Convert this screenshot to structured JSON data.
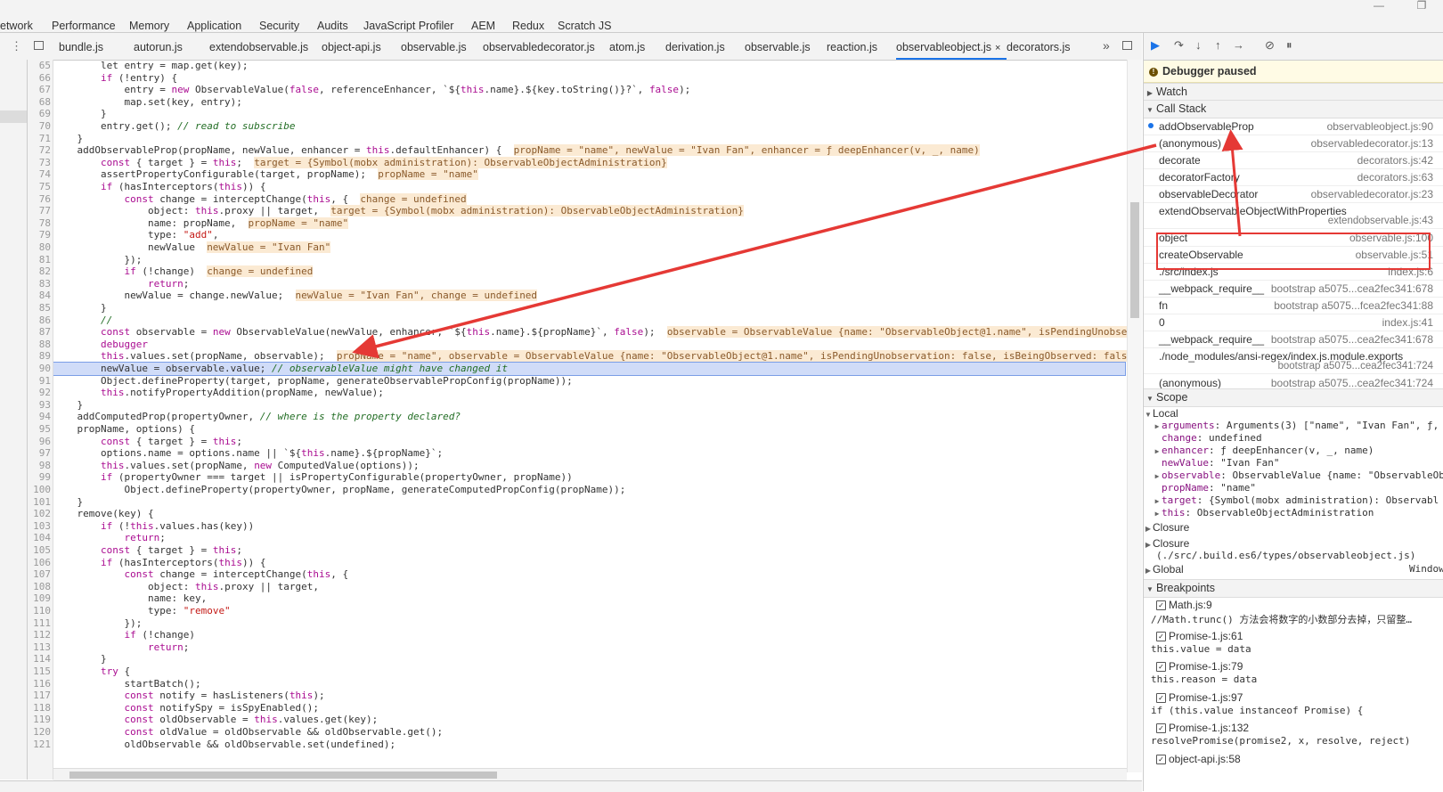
{
  "panel_tabs": [
    "etwork",
    "Performance",
    "Memory",
    "Application",
    "Security",
    "Audits",
    "JavaScript Profiler",
    "AEM",
    "Redux",
    "Scratch JS"
  ],
  "file_tabs": [
    "bundle.js",
    "autorun.js",
    "extendobservable.js",
    "object-api.js",
    "observable.js",
    "observabledecorator.js",
    "atom.js",
    "derivation.js",
    "observable.js",
    "reaction.js",
    "observableobject.js",
    "decorators.js"
  ],
  "active_file_tab": "observableobject.js",
  "close_glyph": "×",
  "more_tabs_glyph": "»",
  "debugger_paused": "Debugger paused",
  "sections": {
    "watch": "Watch",
    "call_stack": "Call Stack",
    "scope": "Scope",
    "breakpoints": "Breakpoints"
  },
  "call_stack": [
    {
      "fn": "addObservableProp",
      "loc": "observableobject.js:90",
      "current": true
    },
    {
      "fn": "(anonymous)",
      "loc": "observabledecorator.js:13"
    },
    {
      "fn": "decorate",
      "loc": "decorators.js:42"
    },
    {
      "fn": "decoratorFactory",
      "loc": "decorators.js:63"
    },
    {
      "fn": "observableDecorator",
      "loc": "observabledecorator.js:23"
    },
    {
      "fn": "extendObservableObjectWithProperties",
      "loc": "extendobservable.js:43"
    },
    {
      "fn": "object",
      "loc": "observable.js:100"
    },
    {
      "fn": "createObservable",
      "loc": "observable.js:51"
    },
    {
      "fn": "./src/index.js",
      "loc": "index.js:6"
    },
    {
      "fn": "__webpack_require__",
      "loc": "bootstrap a5075...cea2fec341:678"
    },
    {
      "fn": "fn",
      "loc": "bootstrap a5075...fcea2fec341:88"
    },
    {
      "fn": "0",
      "loc": "index.js:41"
    },
    {
      "fn": "__webpack_require__",
      "loc": "bootstrap a5075...cea2fec341:678"
    },
    {
      "fn": "./node_modules/ansi-regex/index.js.module.exports",
      "loc": "bootstrap a5075...cea2fec341:724"
    },
    {
      "fn": "(anonymous)",
      "loc": "bootstrap a5075...cea2fec341:724"
    }
  ],
  "scope": {
    "local_label": "Local",
    "local_items": [
      {
        "expand": true,
        "name": "arguments",
        "value": "Arguments(3) [\"name\", \"Ivan Fan\", ƒ,"
      },
      {
        "expand": false,
        "name": "change",
        "value": "undefined"
      },
      {
        "expand": true,
        "name": "enhancer",
        "value": "ƒ deepEnhancer(v, _, name)"
      },
      {
        "expand": false,
        "name": "newValue",
        "value": "\"Ivan Fan\""
      },
      {
        "expand": true,
        "name": "observable",
        "value": "ObservableValue {name: \"ObservableOb"
      },
      {
        "expand": false,
        "name": "propName",
        "value": "\"name\""
      },
      {
        "expand": true,
        "name": "target",
        "value": "{Symbol(mobx administration): Observabl"
      },
      {
        "expand": true,
        "name": "this",
        "value": "ObservableObjectAdministration"
      }
    ],
    "closure1": "Closure",
    "closure2": "Closure",
    "closure2_path": "(./src/.build.es6/types/observableobject.js)",
    "global": "Global",
    "global_value": "Window"
  },
  "breakpoints": [
    {
      "file": "Math.js:9",
      "code": "//Math.trunc() 方法会将数字的小数部分去掉，只留整…"
    },
    {
      "file": "Promise-1.js:61",
      "code": "this.value = data"
    },
    {
      "file": "Promise-1.js:79",
      "code": "this.reason = data"
    },
    {
      "file": "Promise-1.js:97",
      "code": "if (this.value instanceof Promise) {"
    },
    {
      "file": "Promise-1.js:132",
      "code": "resolvePromise(promise2, x, resolve, reject)"
    },
    {
      "file": "object-api.js:58",
      "code": ""
    }
  ],
  "first_line_number": 65,
  "current_line_number": 90,
  "code_lines": [
    [
      [
        "        let entry = map.get(key);",
        "p"
      ]
    ],
    [
      [
        "        ",
        "p"
      ],
      [
        "if",
        "kw"
      ],
      [
        " (!entry) {",
        "p"
      ]
    ],
    [
      [
        "            entry = ",
        "p"
      ],
      [
        "new",
        "kw"
      ],
      [
        " ObservableValue(",
        "p"
      ],
      [
        "false",
        "kw"
      ],
      [
        ", referenceEnhancer, `${",
        "p"
      ],
      [
        "this",
        "kw"
      ],
      [
        ".name}.${key.toString()}?`, ",
        "p"
      ],
      [
        "false",
        "kw"
      ],
      [
        ");",
        "p"
      ]
    ],
    [
      [
        "            map.set(key, entry);",
        "p"
      ]
    ],
    [
      [
        "        }",
        "p"
      ]
    ],
    [
      [
        "        entry.get(); ",
        "p"
      ],
      [
        "// read to subscribe",
        "cm"
      ]
    ],
    [
      [
        "    }",
        "p"
      ]
    ],
    [
      [
        "    addObservableProp(propName, newValue, enhancer = ",
        "p"
      ],
      [
        "this",
        "kw"
      ],
      [
        ".defaultEnhancer) {  ",
        "p"
      ],
      [
        "propName = \"name\", newValue = \"Ivan Fan\", enhancer = ƒ deepEnhancer(v, _, name)",
        "iv"
      ]
    ],
    [
      [
        "        ",
        "p"
      ],
      [
        "const",
        "kw"
      ],
      [
        " { target } = ",
        "p"
      ],
      [
        "this",
        "kw"
      ],
      [
        ";  ",
        "p"
      ],
      [
        "target = {Symbol(mobx administration): ObservableObjectAdministration}",
        "iv"
      ]
    ],
    [
      [
        "        assertPropertyConfigurable(target, propName);  ",
        "p"
      ],
      [
        "propName = \"name\"",
        "iv"
      ]
    ],
    [
      [
        "        ",
        "p"
      ],
      [
        "if",
        "kw"
      ],
      [
        " (hasInterceptors(",
        "p"
      ],
      [
        "this",
        "kw"
      ],
      [
        ")) {",
        "p"
      ]
    ],
    [
      [
        "            ",
        "p"
      ],
      [
        "const",
        "kw"
      ],
      [
        " change = interceptChange(",
        "p"
      ],
      [
        "this",
        "kw"
      ],
      [
        ", {  ",
        "p"
      ],
      [
        "change = undefined",
        "iv"
      ]
    ],
    [
      [
        "                object: ",
        "p"
      ],
      [
        "this",
        "kw"
      ],
      [
        ".proxy || target,  ",
        "p"
      ],
      [
        "target = {Symbol(mobx administration): ObservableObjectAdministration}",
        "iv"
      ]
    ],
    [
      [
        "                name: propName,  ",
        "p"
      ],
      [
        "propName = \"name\"",
        "iv"
      ]
    ],
    [
      [
        "                type: ",
        "p"
      ],
      [
        "\"add\"",
        "str"
      ],
      [
        ",",
        "p"
      ]
    ],
    [
      [
        "                newValue  ",
        "p"
      ],
      [
        "newValue = \"Ivan Fan\"",
        "iv"
      ]
    ],
    [
      [
        "            });",
        "p"
      ]
    ],
    [
      [
        "            ",
        "p"
      ],
      [
        "if",
        "kw"
      ],
      [
        " (!change)  ",
        "p"
      ],
      [
        "change = undefined",
        "iv"
      ]
    ],
    [
      [
        "                ",
        "p"
      ],
      [
        "return",
        "kw"
      ],
      [
        ";",
        "p"
      ]
    ],
    [
      [
        "            newValue = change.newValue;  ",
        "p"
      ],
      [
        "newValue = \"Ivan Fan\", change = undefined",
        "iv"
      ]
    ],
    [
      [
        "        }",
        "p"
      ]
    ],
    [
      [
        "        ",
        "p"
      ],
      [
        "//",
        "cm"
      ]
    ],
    [
      [
        "        ",
        "p"
      ],
      [
        "const",
        "kw"
      ],
      [
        " observable = ",
        "p"
      ],
      [
        "new",
        "kw"
      ],
      [
        " ObservableValue(newValue, enhancer, `${",
        "p"
      ],
      [
        "this",
        "kw"
      ],
      [
        ".name}.${propName}`, ",
        "p"
      ],
      [
        "false",
        "kw"
      ],
      [
        ");  ",
        "p"
      ],
      [
        "observable = ObservableValue {name: \"ObservableObject@1.name\", isPendingUnobse",
        "iv"
      ]
    ],
    [
      [
        "        ",
        "p"
      ],
      [
        "debugger",
        "kw"
      ]
    ],
    [
      [
        "        ",
        "p"
      ],
      [
        "this",
        "kw"
      ],
      [
        ".values.set(propName, observable);  ",
        "p"
      ],
      [
        "propName = \"name\", observable = ObservableValue {name: \"ObservableObject@1.name\", isPendingUnobservation: false, isBeingObserved: fals",
        "iv"
      ]
    ],
    [
      [
        "        newValue = observable.value; ",
        "p"
      ],
      [
        "// observableValue might have changed it",
        "cm"
      ]
    ],
    [
      [
        "        Object.defineProperty(target, propName, generateObservablePropConfig(propName));",
        "p"
      ]
    ],
    [
      [
        "        ",
        "p"
      ],
      [
        "this",
        "kw"
      ],
      [
        ".notifyPropertyAddition(propName, newValue);",
        "p"
      ]
    ],
    [
      [
        "    }",
        "p"
      ]
    ],
    [
      [
        "    addComputedProp(propertyOwner, ",
        "p"
      ],
      [
        "// where is the property declared?",
        "cm"
      ]
    ],
    [
      [
        "    propName, options) {",
        "p"
      ]
    ],
    [
      [
        "        ",
        "p"
      ],
      [
        "const",
        "kw"
      ],
      [
        " { target } = ",
        "p"
      ],
      [
        "this",
        "kw"
      ],
      [
        ";",
        "p"
      ]
    ],
    [
      [
        "        options.name = options.name || `${",
        "p"
      ],
      [
        "this",
        "kw"
      ],
      [
        ".name}.${propName}`;",
        "p"
      ]
    ],
    [
      [
        "        ",
        "p"
      ],
      [
        "this",
        "kw"
      ],
      [
        ".values.set(propName, ",
        "p"
      ],
      [
        "new",
        "kw"
      ],
      [
        " ComputedValue(options));",
        "p"
      ]
    ],
    [
      [
        "        ",
        "p"
      ],
      [
        "if",
        "kw"
      ],
      [
        " (propertyOwner === target || isPropertyConfigurable(propertyOwner, propName))",
        "p"
      ]
    ],
    [
      [
        "            Object.defineProperty(propertyOwner, propName, generateComputedPropConfig(propName));",
        "p"
      ]
    ],
    [
      [
        "    }",
        "p"
      ]
    ],
    [
      [
        "    remove(key) {",
        "p"
      ]
    ],
    [
      [
        "        ",
        "p"
      ],
      [
        "if",
        "kw"
      ],
      [
        " (!",
        "p"
      ],
      [
        "this",
        "kw"
      ],
      [
        ".values.has(key))",
        "p"
      ]
    ],
    [
      [
        "            ",
        "p"
      ],
      [
        "return",
        "kw"
      ],
      [
        ";",
        "p"
      ]
    ],
    [
      [
        "        ",
        "p"
      ],
      [
        "const",
        "kw"
      ],
      [
        " { target } = ",
        "p"
      ],
      [
        "this",
        "kw"
      ],
      [
        ";",
        "p"
      ]
    ],
    [
      [
        "        ",
        "p"
      ],
      [
        "if",
        "kw"
      ],
      [
        " (hasInterceptors(",
        "p"
      ],
      [
        "this",
        "kw"
      ],
      [
        ")) {",
        "p"
      ]
    ],
    [
      [
        "            ",
        "p"
      ],
      [
        "const",
        "kw"
      ],
      [
        " change = interceptChange(",
        "p"
      ],
      [
        "this",
        "kw"
      ],
      [
        ", {",
        "p"
      ]
    ],
    [
      [
        "                object: ",
        "p"
      ],
      [
        "this",
        "kw"
      ],
      [
        ".proxy || target,",
        "p"
      ]
    ],
    [
      [
        "                name: key,",
        "p"
      ]
    ],
    [
      [
        "                type: ",
        "p"
      ],
      [
        "\"remove\"",
        "str"
      ]
    ],
    [
      [
        "            });",
        "p"
      ]
    ],
    [
      [
        "            ",
        "p"
      ],
      [
        "if",
        "kw"
      ],
      [
        " (!change)",
        "p"
      ]
    ],
    [
      [
        "                ",
        "p"
      ],
      [
        "return",
        "kw"
      ],
      [
        ";",
        "p"
      ]
    ],
    [
      [
        "        }",
        "p"
      ]
    ],
    [
      [
        "        ",
        "p"
      ],
      [
        "try",
        "kw"
      ],
      [
        " {",
        "p"
      ]
    ],
    [
      [
        "            startBatch();",
        "p"
      ]
    ],
    [
      [
        "            ",
        "p"
      ],
      [
        "const",
        "kw"
      ],
      [
        " notify = hasListeners(",
        "p"
      ],
      [
        "this",
        "kw"
      ],
      [
        ");",
        "p"
      ]
    ],
    [
      [
        "            ",
        "p"
      ],
      [
        "const",
        "kw"
      ],
      [
        " notifySpy = isSpyEnabled();",
        "p"
      ]
    ],
    [
      [
        "            ",
        "p"
      ],
      [
        "const",
        "kw"
      ],
      [
        " oldObservable = ",
        "p"
      ],
      [
        "this",
        "kw"
      ],
      [
        ".values.get(key);",
        "p"
      ]
    ],
    [
      [
        "            ",
        "p"
      ],
      [
        "const",
        "kw"
      ],
      [
        " oldValue = oldObservable && oldObservable.get();",
        "p"
      ]
    ],
    [
      [
        "            oldObservable && oldObservable.set(undefined);",
        "p"
      ]
    ]
  ]
}
